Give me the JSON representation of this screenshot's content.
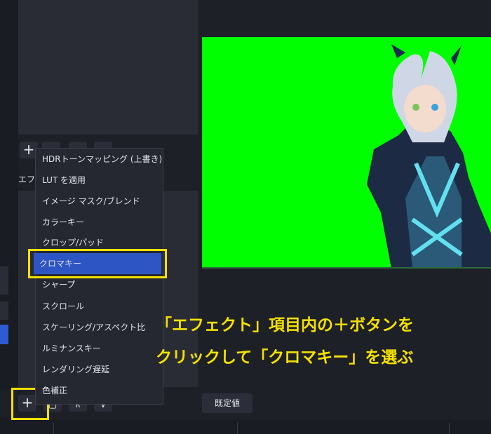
{
  "filters_panel": {
    "effects_label": "エフェ"
  },
  "toolbar": {
    "add_label": "+"
  },
  "context_menu": {
    "items": [
      "HDRトーンマッピング (上書き)",
      "LUT を適用",
      "イメージ マスク/ブレンド",
      "カラーキー",
      "クロップ/パッド",
      "クロマキー",
      "シャープ",
      "スクロール",
      "スケーリング/アスペクト比",
      "ルミナンスキー",
      "レンダリング遅延",
      "色補正"
    ],
    "selected_item": "クロマキー"
  },
  "caption": {
    "line1": "「エフェクト」項目内の＋ボタンを",
    "line2": "クリックして「クロマキー」を選ぶ"
  },
  "default_button_label": "既定値",
  "colors": {
    "chroma_green": "#00ff00",
    "highlight_yellow": "#f5e100",
    "selection_blue": "#2d55c4"
  }
}
